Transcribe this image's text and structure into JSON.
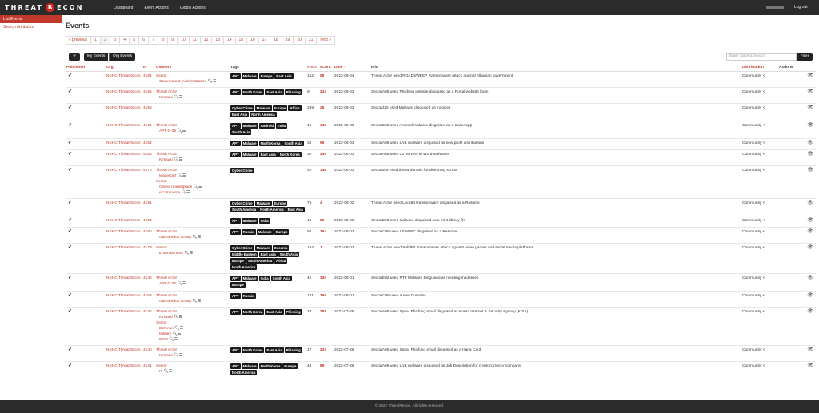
{
  "brand": {
    "left": "THREAT",
    "mark": "R",
    "right": "ECON"
  },
  "nav": {
    "dashboard": "Dashboard",
    "event_actions": "Event Actions",
    "global_actions": "Global Actions",
    "logout": "Log out"
  },
  "sidebar": {
    "items": [
      {
        "label": "List Events",
        "active": true
      },
      {
        "label": "Search Attributes",
        "active": false
      }
    ]
  },
  "page_title": "Events",
  "pagination": [
    "« previous",
    "1",
    "2",
    "3",
    "4",
    "5",
    "6",
    "7",
    "8",
    "9",
    "10",
    "11",
    "12",
    "13",
    "14",
    "15",
    "16",
    "17",
    "18",
    "19",
    "20",
    "21",
    "next »"
  ],
  "pagination_current": "2",
  "toolbar": {
    "my_events": "My Events",
    "org_events": "Org Events",
    "search_placeholder": "Enter value to search",
    "filter": "Filter"
  },
  "columns": [
    "Published",
    "Org",
    "Id",
    "Clusters",
    "Tags",
    "#Attr.",
    "#Corr.",
    "Date ↑",
    "Info",
    "Distribution",
    "Actions"
  ],
  "rows": [
    {
      "org": "NSHC ThreatRecon",
      "id": "4184",
      "clusters": [
        {
          "text": "Sector",
          "sub": false
        },
        {
          "text": "Government, Administration",
          "sub": true
        }
      ],
      "tags": [
        "APT",
        "Malware",
        "Europe",
        "East Asia"
      ],
      "attr": "162",
      "corr": "58",
      "date": "2022-08-04",
      "info": "Threat Actor used ROADSWEEP Ransomware attack against Albanian government",
      "dist": "Community"
    },
    {
      "org": "NSHC ThreatRecon",
      "id": "4155",
      "clusters": [
        {
          "text": "Threat Actor",
          "sub": false
        },
        {
          "text": "Kimsuki",
          "sub": true
        }
      ],
      "tags": [
        "APT",
        "North Korea",
        "East Asia",
        "Phishing"
      ],
      "attr": "9",
      "corr": "247",
      "date": "2022-08-03",
      "info": "SectorA05 used Phishing website disguised as a Portal website login",
      "dist": "Community"
    },
    {
      "org": "NSHC ThreatRecon",
      "id": "4158",
      "clusters": [],
      "tags": [
        "Cyber Crime",
        "Malware",
        "Europe",
        "Africa",
        "East Asia",
        "North America"
      ],
      "attr": "239",
      "corr": "25",
      "date": "2022-08-03",
      "info": "SectorJ20 used Malware disguised as invoices",
      "dist": "Community"
    },
    {
      "org": "NSHC ThreatRecon",
      "id": "4161",
      "clusters": [
        {
          "text": "Threat Actor",
          "sub": false
        },
        {
          "text": "APT-C-35",
          "sub": true
        }
      ],
      "tags": [
        "APT",
        "Malware",
        "Android",
        "India",
        "South Asia"
      ],
      "attr": "15",
      "corr": "146",
      "date": "2022-08-03",
      "info": "SectorE02 used Android malware disguised as a Caller app",
      "dist": "Community"
    },
    {
      "org": "NSHC ThreatRecon",
      "id": "4152",
      "clusters": [],
      "tags": [
        "APT",
        "Malware",
        "North Korea",
        "South Asia"
      ],
      "attr": "35",
      "corr": "96",
      "date": "2022-08-03",
      "info": "SectorA06 used LNK malware disguised as new profit distributions",
      "dist": "Community"
    },
    {
      "org": "NSHC ThreatRecon",
      "id": "4166",
      "clusters": [
        {
          "text": "Threat Actor",
          "sub": false
        },
        {
          "text": "Kimsuki",
          "sub": true
        }
      ],
      "tags": [
        "APT",
        "Malware",
        "East Asia",
        "North Korea"
      ],
      "attr": "30",
      "corr": "259",
      "date": "2022-08-03",
      "info": "SectorA05 used C2 servers in Word Malwares",
      "dist": "Community"
    },
    {
      "org": "NSHC ThreatRecon",
      "id": "4170",
      "clusters": [
        {
          "text": "Threat Actor",
          "sub": false
        },
        {
          "text": "MageCart",
          "sub": true
        },
        {
          "text": "Sector",
          "sub": false
        },
        {
          "text": "Online marketplace",
          "sub": true
        },
        {
          "text": "eCommerce",
          "sub": true
        }
      ],
      "tags": [
        "Cyber Crime"
      ],
      "attr": "42",
      "corr": "148",
      "date": "2022-08-03",
      "info": "SectorJ09 used a new domain for skimming scripts",
      "dist": "Community"
    },
    {
      "org": "NSHC ThreatRecon",
      "id": "4151",
      "clusters": [],
      "tags": [
        "Cyber Crime",
        "Malware",
        "Europe",
        "South America",
        "North America",
        "East Asia"
      ],
      "attr": "75",
      "corr": "4",
      "date": "2022-08-02",
      "info": "Threat Actor used LockBit Ransomware disguised as a Resume",
      "dist": "Community"
    },
    {
      "org": "NSHC ThreatRecon",
      "id": "4154",
      "clusters": [],
      "tags": [
        "APT",
        "Malware",
        "India"
      ],
      "attr": "13",
      "corr": "20",
      "date": "2022-08-02",
      "info": "SectorE03 used Malware disguised as a print library file",
      "dist": "Community"
    },
    {
      "org": "NSHC ThreatRecon",
      "id": "4160",
      "clusters": [
        {
          "text": "Threat Actor",
          "sub": false
        },
        {
          "text": "Gamaredon Group",
          "sub": true
        }
      ],
      "tags": [
        "APT",
        "Russia",
        "Malware",
        "Europe"
      ],
      "attr": "50",
      "corr": "164",
      "date": "2022-08-02",
      "info": "SectorC08 used UltraVNC disguised as a Resume",
      "dist": "Community"
    },
    {
      "org": "NSHC ThreatRecon",
      "id": "4179",
      "clusters": [
        {
          "text": "Sector",
          "sub": false
        },
        {
          "text": "Entertainment",
          "sub": true
        }
      ],
      "tags": [
        "Cyber Crime",
        "Malware",
        "Oceania",
        "Middle Eastern",
        "East Asia",
        "South Asia",
        "Europe",
        "South America",
        "Africa",
        "North America"
      ],
      "attr": "164",
      "corr": "1",
      "date": "2022-08-02",
      "info": "Threat Actor used SolidBit Ransomware attack against video games and social media platforms",
      "dist": "Community"
    },
    {
      "org": "NSHC ThreatRecon",
      "id": "4145",
      "clusters": [
        {
          "text": "Threat Actor",
          "sub": false
        },
        {
          "text": "APT-C-35",
          "sub": true
        }
      ],
      "tags": [
        "APT",
        "Malware",
        "India",
        "South Asia",
        "Europe"
      ],
      "attr": "42",
      "corr": "130",
      "date": "2022-08-01",
      "info": "SectorE02 used RTF Malware Disguised as meeting modalities",
      "dist": "Community"
    },
    {
      "org": "NSHC ThreatRecon",
      "id": "4153",
      "clusters": [
        {
          "text": "Threat Actor",
          "sub": false
        },
        {
          "text": "Gamaredon Group",
          "sub": true
        }
      ],
      "tags": [
        "APT",
        "Russia"
      ],
      "attr": "131",
      "corr": "169",
      "date": "2022-08-01",
      "info": "SectorC08 used a new Domains",
      "dist": "Community"
    },
    {
      "org": "NSHC ThreatRecon",
      "id": "4136",
      "clusters": [
        {
          "text": "Threat Actor",
          "sub": false
        },
        {
          "text": "Kimsuki",
          "sub": true
        },
        {
          "text": "Sector",
          "sub": false
        },
        {
          "text": "Defense",
          "sub": true
        },
        {
          "text": "Military",
          "sub": true
        },
        {
          "text": "NGO",
          "sub": true
        }
      ],
      "tags": [
        "APT",
        "North Korea",
        "East Asia",
        "Phishing"
      ],
      "attr": "23",
      "corr": "255",
      "date": "2022-07-28",
      "info": "SectorA05 used Spear Phishing email disguised as Korea Internet & Security Agency (KISA)",
      "dist": "Community"
    },
    {
      "org": "NSHC ThreatRecon",
      "id": "4140",
      "clusters": [
        {
          "text": "Threat Actor",
          "sub": false
        },
        {
          "text": "Kimsuki",
          "sub": true
        }
      ],
      "tags": [
        "APT",
        "North Korea",
        "East Asia",
        "Phishing"
      ],
      "attr": "17",
      "corr": "247",
      "date": "2022-07-28",
      "info": "SectorA05 used Spear Phishing email disguised as a Hana Card",
      "dist": "Community"
    },
    {
      "org": "NSHC ThreatRecon",
      "id": "4141",
      "clusters": [
        {
          "text": "Sector",
          "sub": false
        },
        {
          "text": "IT",
          "sub": true
        }
      ],
      "tags": [
        "APT",
        "Malware",
        "North Korea",
        "Europe",
        "North America"
      ],
      "attr": "44",
      "corr": "89",
      "date": "2022-07-28",
      "info": "SectorA06 used LNK malware disguised as Job Description for cryptocurrency company",
      "dist": "Community"
    }
  ],
  "footer": "© 2022 ThreatRecon. All rights reserved."
}
